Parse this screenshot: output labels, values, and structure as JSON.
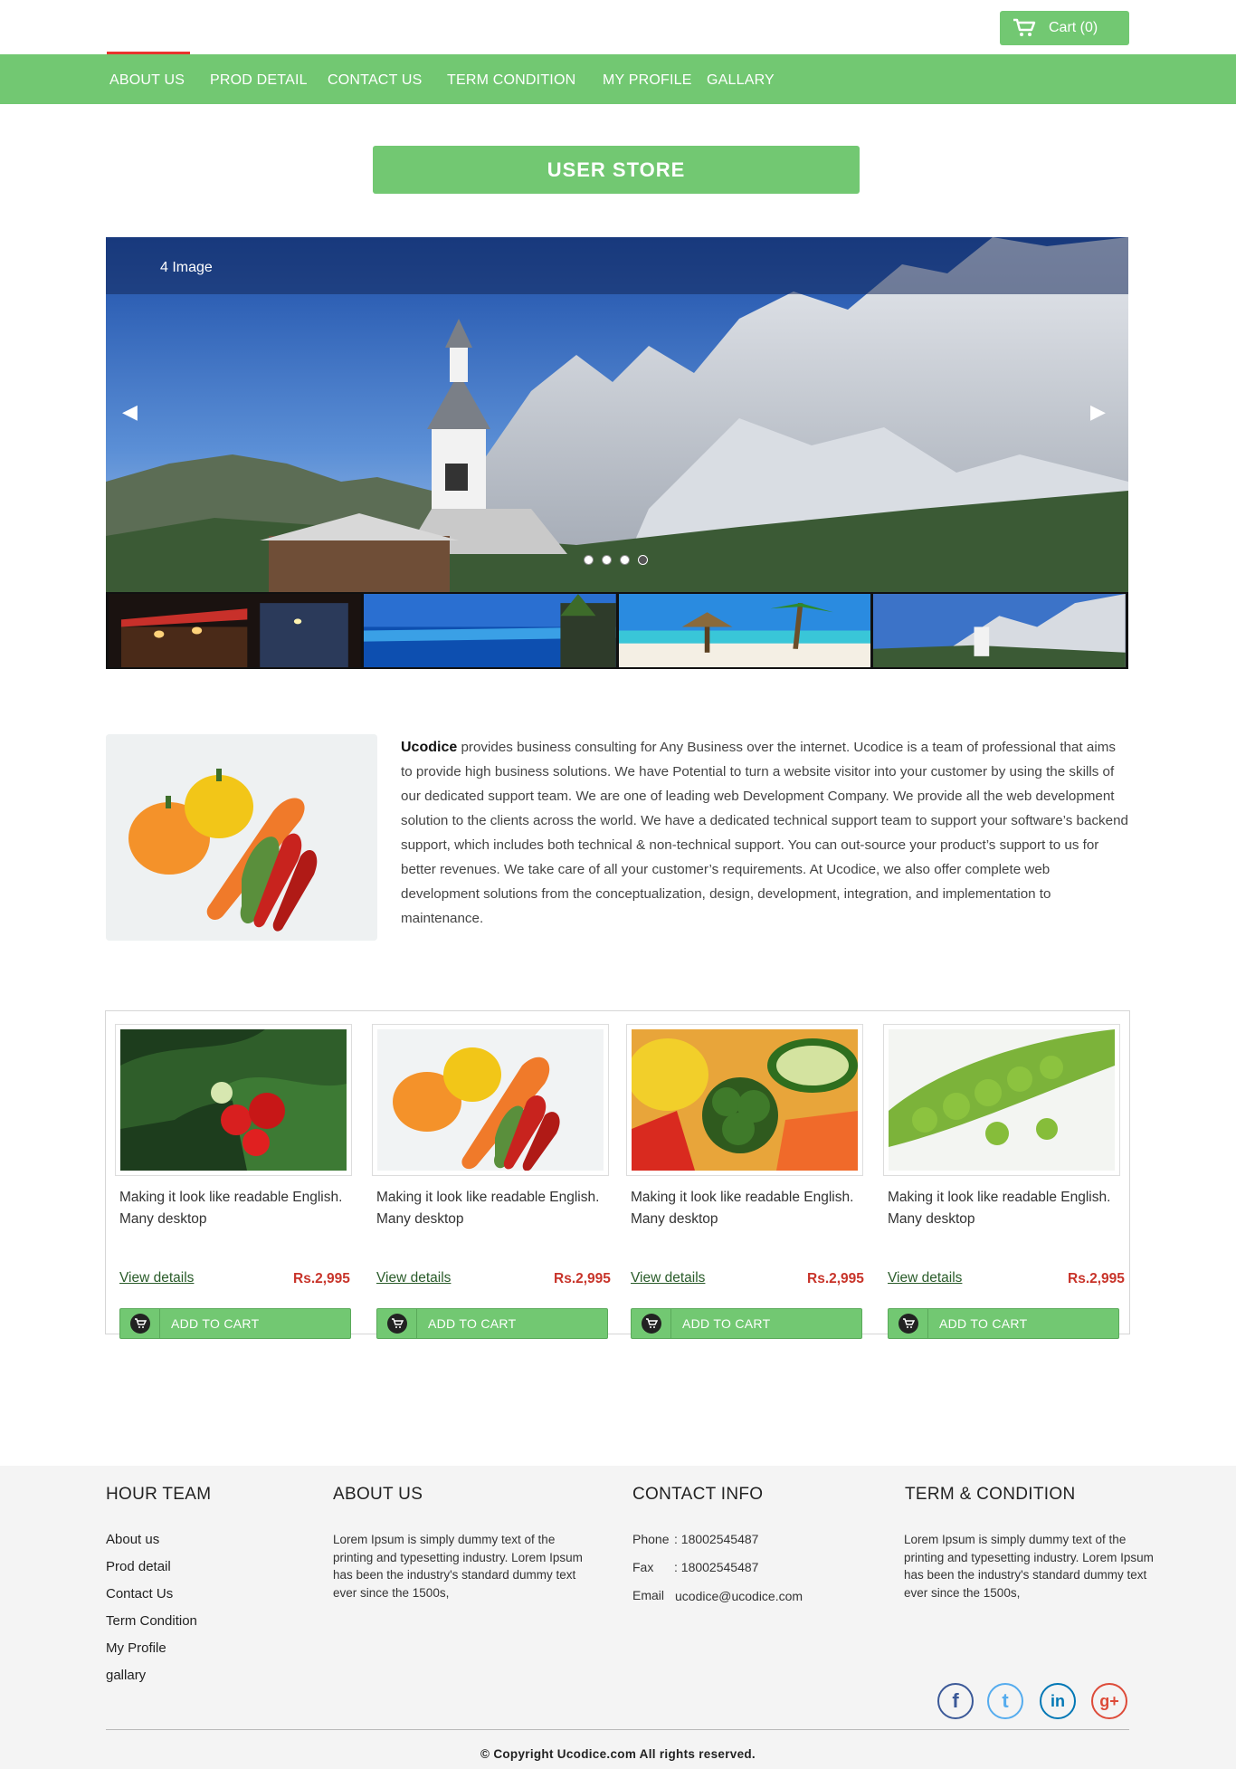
{
  "header": {
    "cart_label": "Cart (0)",
    "cart_icon": "cart-icon"
  },
  "nav": {
    "items": [
      {
        "label": "ABOUT US"
      },
      {
        "label": "PROD DETAIL"
      },
      {
        "label": "CONTACT US"
      },
      {
        "label": "TERM CONDITION"
      },
      {
        "label": "MY PROFILE"
      },
      {
        "label": "GALLARY"
      }
    ],
    "accent_color": "#e8342c"
  },
  "title": "USER STORE",
  "slider": {
    "caption": "4 Image",
    "prev_glyph": "◀",
    "next_glyph": "▶",
    "dot_count": 4,
    "active_dot": 4,
    "thumbnails": [
      "night-street",
      "infinity-pool",
      "beach-umbrella",
      "mountain-church"
    ]
  },
  "about": {
    "brand": "Ucodice",
    "text": " provides business consulting for Any Business over the internet. Ucodice is a team of professional that aims to provide high business solutions. We have Potential to turn a website visitor into your customer by using the skills of our dedicated support team. We are one of leading web Development Company. We provide all the web development solution to the clients across the world.  We have a dedicated technical support team to support your software’s backend support, which includes both technical & non-technical support.  You can out-source your product’s support to us for better revenues. We take care of all your customer’s requirements.  At Ucodice, we also offer complete web development solutions from the conceptualization, design, development, integration, and implementation to maintenance."
  },
  "products": [
    {
      "image": "strawberries",
      "desc": "Making it look like readable English. Many desktop",
      "link": "View details",
      "price": "Rs.2,995",
      "button": "ADD TO CART"
    },
    {
      "image": "peppers-carrots",
      "desc": "Making it look like readable English. Many desktop",
      "link": "View details",
      "price": "Rs.2,995",
      "button": "ADD TO CART"
    },
    {
      "image": "mixed-vegetables",
      "desc": "Making it look like readable English. Many desktop",
      "link": "View details",
      "price": "Rs.2,995",
      "button": "ADD TO CART"
    },
    {
      "image": "green-peas",
      "desc": "Making it look like readable English. Many desktop",
      "link": "View details",
      "price": "Rs.2,995",
      "button": "ADD TO CART"
    }
  ],
  "footer": {
    "team": {
      "heading": "HOUR TEAM",
      "links": [
        "About us",
        "Prod detail",
        "Contact Us",
        "Term Condition",
        "My Profile",
        "gallary"
      ]
    },
    "about": {
      "heading": "ABOUT US",
      "text": "Lorem Ipsum is simply dummy text of the printing and typesetting industry. Lorem Ipsum has been the industry's standard dummy text ever since the 1500s,"
    },
    "contact": {
      "heading": "CONTACT INFO",
      "phone_label": "Phone",
      "phone": ": 18002545487",
      "fax_label": "Fax",
      "fax": ": 18002545487",
      "email_label": "Email",
      "email": "ucodice@ucodice.com"
    },
    "terms": {
      "heading": "TERM & CONDITION",
      "text": "Lorem Ipsum is simply dummy text of the printing and typesetting industry. Lorem Ipsum has been the industry's standard dummy text ever since the 1500s,"
    },
    "social": [
      {
        "name": "facebook-icon",
        "glyph": "f",
        "color": "#3b5998"
      },
      {
        "name": "twitter-icon",
        "glyph": "t",
        "color": "#55acee"
      },
      {
        "name": "linkedin-icon",
        "glyph": "in",
        "color": "#0077b5"
      },
      {
        "name": "googleplus-icon",
        "glyph": "g+",
        "color": "#dd4b39"
      }
    ],
    "copyright": "© Copyright Ucodice.com All rights reserved."
  },
  "colors": {
    "brand_green": "#72c872",
    "price_red": "#c8342a"
  }
}
